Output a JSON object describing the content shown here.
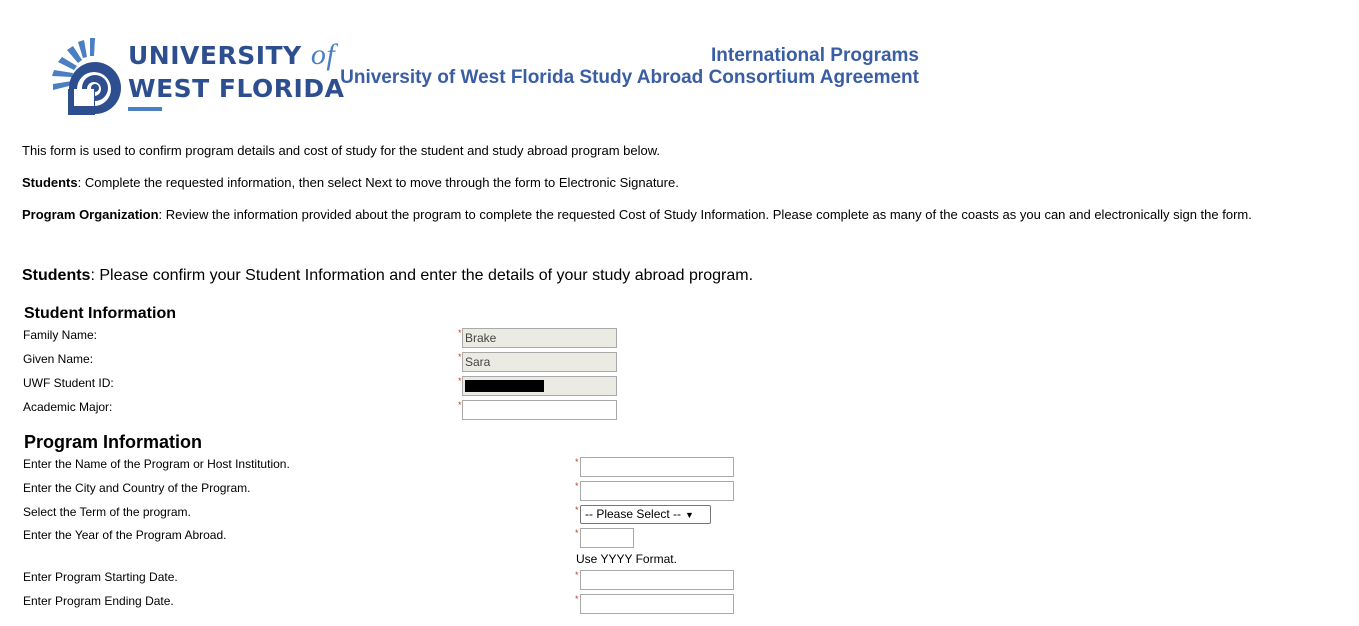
{
  "logo": {
    "line1": "UNIVERSITY",
    "of": "of",
    "line2": "WEST FLORIDA"
  },
  "header": {
    "department": "International Programs",
    "title": "University of West Florida Study Abroad Consortium Agreement"
  },
  "intro": {
    "line1": "This form is used to confirm program details and cost of study for the student and study abroad program below.",
    "students_label": "Students",
    "students_text": ": Complete the requested information, then select Next to move through the form to Electronic Signature.",
    "org_label": "Program Organization",
    "org_text": ": Review the information provided about the program to complete the requested Cost of Study Information. Please complete as many of the coasts as you can and electronically sign the form."
  },
  "lead": {
    "label": "Students",
    "text": ": Please confirm your Student Information and enter the details of your study abroad program."
  },
  "student_info": {
    "title": "Student Information",
    "family_name_label": "Family Name:",
    "family_name_value": "Brake",
    "given_name_label": "Given Name:",
    "given_name_value": "Sara",
    "student_id_label": "UWF Student ID:",
    "student_id_value": "",
    "major_label": "Academic Major:",
    "major_value": ""
  },
  "program_info": {
    "title": "Program Information",
    "name_label": "Enter the Name of the Program or Host Institution.",
    "name_value": "",
    "city_label": "Enter the City and Country of the Program.",
    "city_value": "",
    "term_label": "Select the Term of the program.",
    "term_selected": "-- Please Select --",
    "year_label": "Enter the Year of the Program Abroad.",
    "year_value": "",
    "year_hint": "Use YYYY Format.",
    "start_label": "Enter Program Starting Date.",
    "start_value": "",
    "end_label": "Enter Program Ending Date.",
    "end_value": ""
  },
  "required_mark": "*",
  "colors": {
    "brand": "#2e4f8f",
    "header_title": "#3a5ea3",
    "required": "#c0392b",
    "readonly_field": "#ebebe4"
  }
}
